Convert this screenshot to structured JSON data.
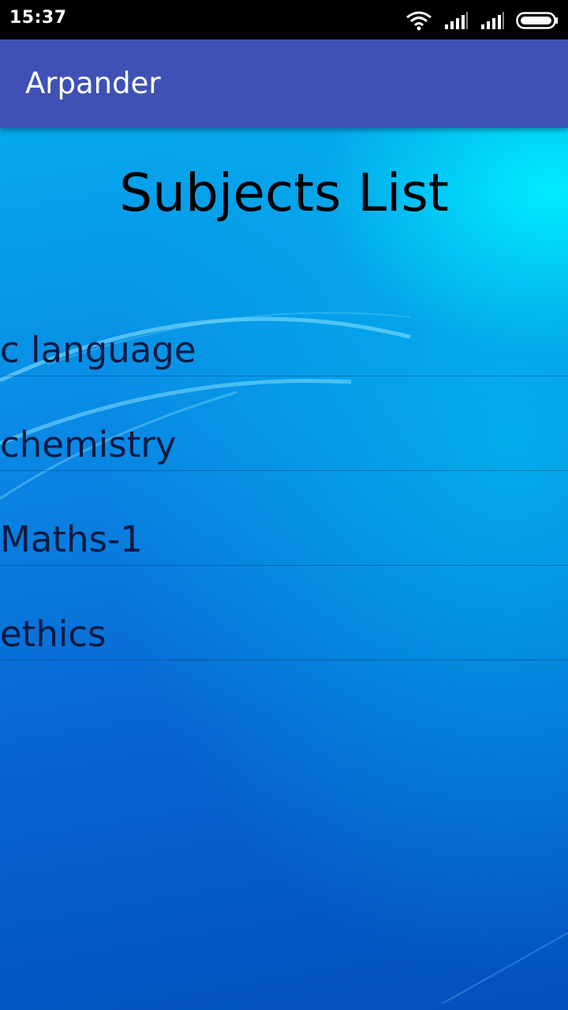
{
  "status_bar": {
    "time": "15:37",
    "icons": [
      "wifi-icon",
      "signal-icon",
      "signal-icon",
      "battery-icon"
    ]
  },
  "app_bar": {
    "title": "Arpander",
    "color": "#3f51b5"
  },
  "main": {
    "title": "Subjects List",
    "subjects": [
      {
        "label": "c language"
      },
      {
        "label": "chemistry"
      },
      {
        "label": "Maths-1"
      },
      {
        "label": "ethics"
      }
    ]
  }
}
